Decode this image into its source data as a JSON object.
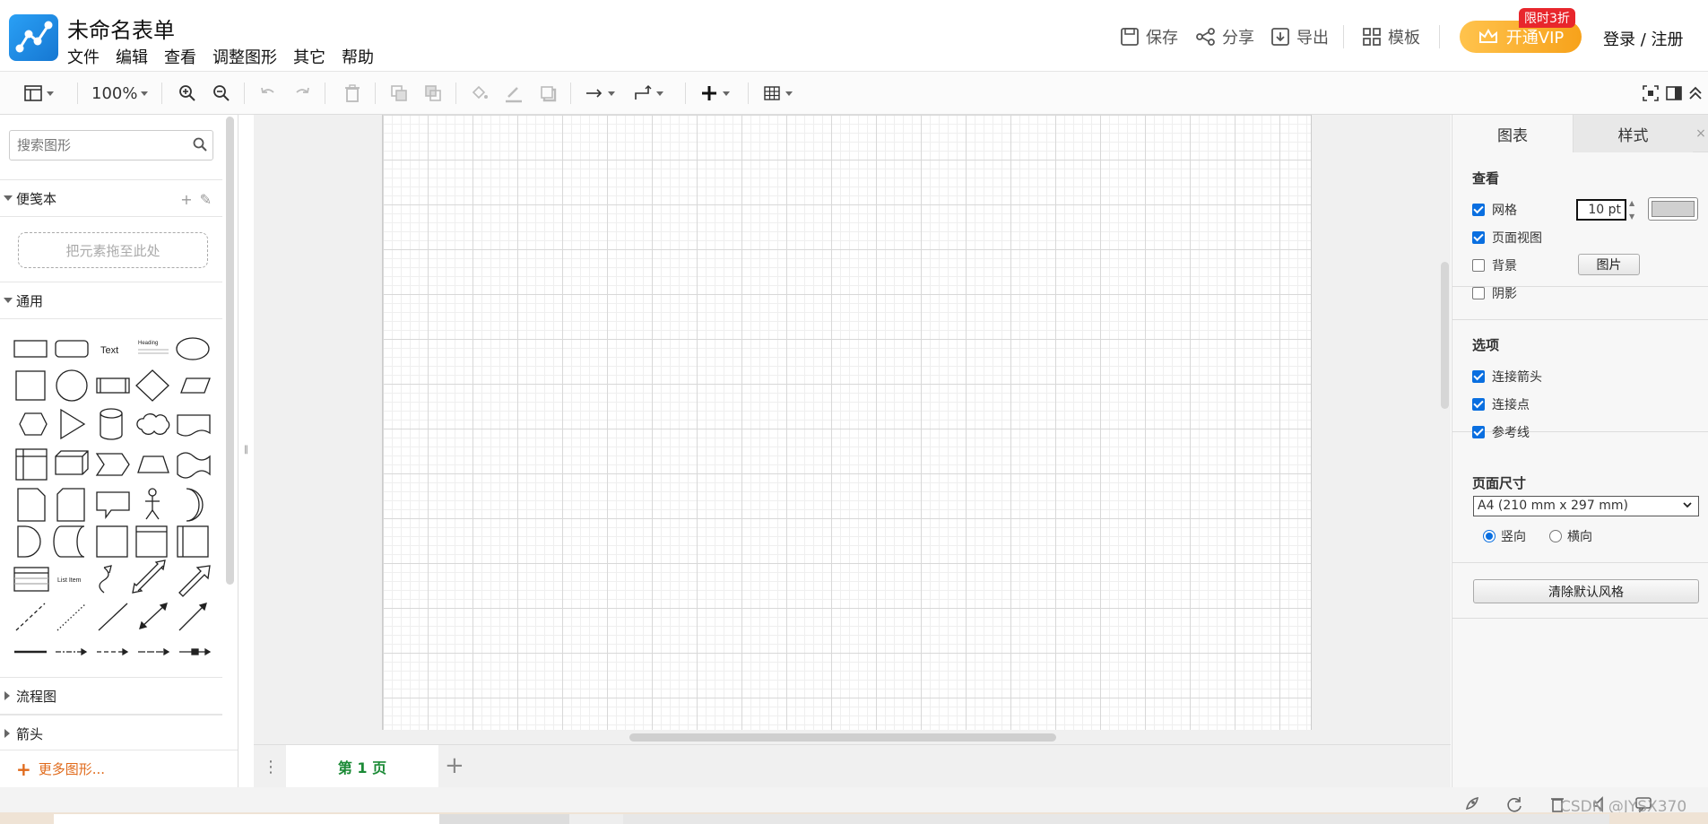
{
  "app": {
    "title": "未命名表单"
  },
  "menu": [
    "文件",
    "编辑",
    "查看",
    "调整图形",
    "其它",
    "帮助"
  ],
  "header": {
    "save": "保存",
    "share": "分享",
    "export": "导出",
    "templates": "模板",
    "vip_button": "开通VIP",
    "vip_badge": "限时3折",
    "login": "登录 / 注册"
  },
  "toolbar": {
    "zoom": "100%"
  },
  "left": {
    "search_placeholder": "搜索图形",
    "scratchpad": "便笺本",
    "dropzone": "把元素拖至此处",
    "general": "通用",
    "flowchart": "流程图",
    "arrows": "箭头",
    "more_shapes": "更多图形...",
    "shape_text": "Text",
    "shape_heading": "Heading",
    "shape_list_item": "List Item"
  },
  "pages": {
    "tab1": "第 1 页"
  },
  "right": {
    "tab_diagram": "图表",
    "tab_style": "样式",
    "view_title": "查看",
    "grid": "网格",
    "grid_size": "10 pt",
    "page_view": "页面视图",
    "background": "背景",
    "image_button": "图片",
    "shadow": "阴影",
    "options_title": "选项",
    "connection_arrows": "连接箭头",
    "connection_points": "连接点",
    "guides": "参考线",
    "page_size_title": "页面尺寸",
    "page_size_value": "A4 (210 mm x 297 mm)",
    "portrait": "竖向",
    "landscape": "横向",
    "clear_style_button": "清除默认风格"
  },
  "watermark": "CSDN @JYSX370",
  "colors": {
    "vip": "#f7a21b",
    "badge": "#e8262c",
    "accent": "#0a6fe0",
    "page_tab": "#1b8a36",
    "more_shapes": "#e06a1b"
  }
}
